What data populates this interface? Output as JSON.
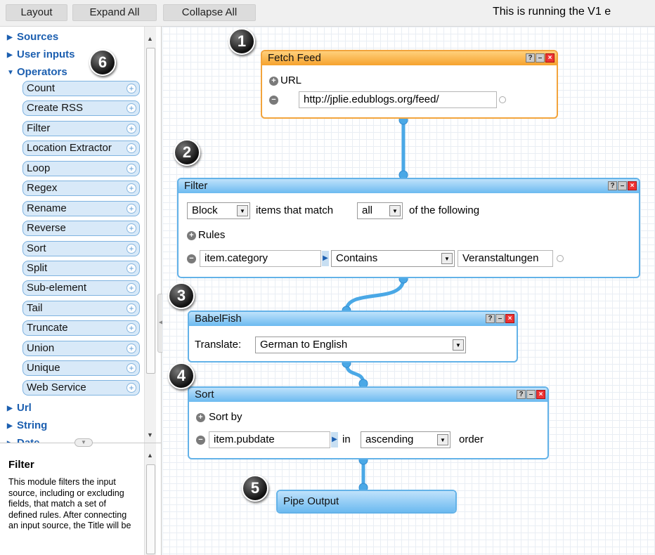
{
  "toolbar": {
    "layout": "Layout",
    "expand_all": "Expand All",
    "collapse_all": "Collapse All",
    "note": "This is running the V1 e"
  },
  "library": {
    "categories_top": [
      "Sources",
      "User inputs",
      "Operators"
    ],
    "operators": [
      "Count",
      "Create RSS",
      "Filter",
      "Location Extractor",
      "Loop",
      "Regex",
      "Rename",
      "Reverse",
      "Sort",
      "Split",
      "Sub-element",
      "Tail",
      "Truncate",
      "Union",
      "Unique",
      "Web Service"
    ],
    "categories_bottom": [
      "Url",
      "String",
      "Date"
    ]
  },
  "description": {
    "title": "Filter",
    "body": "This module filters the input source, including or excluding fields, that match a set of defined rules. After connecting an input source, the Title will be"
  },
  "badges": [
    "1",
    "2",
    "3",
    "4",
    "5",
    "6"
  ],
  "modules": {
    "fetch_feed": {
      "title": "Fetch Feed",
      "url_label": "URL",
      "url_value": "http://jplie.edublogs.org/feed/"
    },
    "filter": {
      "title": "Filter",
      "mode": "Block",
      "text1": "items that match",
      "match": "all",
      "text2": "of the following",
      "rules_label": "Rules",
      "rule_field": "item.category",
      "rule_op": "Contains",
      "rule_value": "Veranstaltungen"
    },
    "babelfish": {
      "title": "BabelFish",
      "label": "Translate:",
      "value": "German to English"
    },
    "sort": {
      "title": "Sort",
      "sortby_label": "Sort by",
      "field": "item.pubdate",
      "in_label": "in",
      "order": "ascending",
      "order_label": "order"
    },
    "output": {
      "title": "Pipe Output"
    }
  },
  "colors": {
    "module_blue": "#63b2e8",
    "module_orange": "#f2a43c",
    "wire": "#4aa8e6",
    "category_text": "#1c5fb0"
  }
}
